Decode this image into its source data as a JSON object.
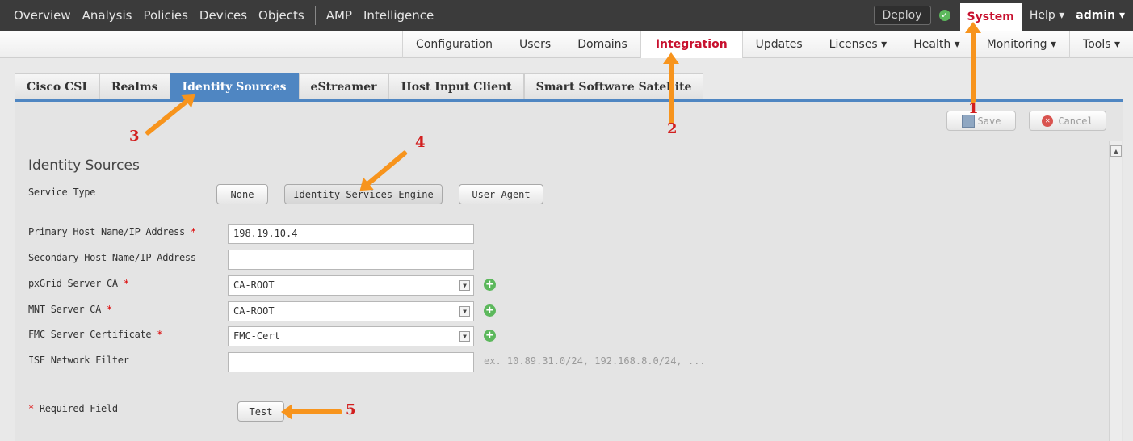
{
  "topnav": {
    "items": [
      "Overview",
      "Analysis",
      "Policies",
      "Devices",
      "Objects",
      "AMP",
      "Intelligence"
    ],
    "deploy": "Deploy",
    "system": "System",
    "help": "Help ▾",
    "admin": "admin ▾"
  },
  "subnav": {
    "items": [
      "Configuration",
      "Users",
      "Domains",
      "Integration",
      "Updates",
      "Licenses ▾",
      "Health ▾",
      "Monitoring ▾",
      "Tools ▾"
    ],
    "active": "Integration"
  },
  "tabs": {
    "items": [
      "Cisco CSI",
      "Realms",
      "Identity Sources",
      "eStreamer",
      "Host Input Client",
      "Smart Software Satellite"
    ],
    "active": "Identity Sources"
  },
  "actions": {
    "save": "Save",
    "cancel": "Cancel"
  },
  "form": {
    "title": "Identity Sources",
    "service_type_label": "Service Type",
    "service_types": [
      "None",
      "Identity Services Engine",
      "User Agent"
    ],
    "primary_host_label": "Primary Host Name/IP Address",
    "primary_host_value": "198.19.10.4",
    "secondary_host_label": "Secondary Host Name/IP Address",
    "secondary_host_value": "",
    "pxgrid_ca_label": "pxGrid Server CA",
    "pxgrid_ca_value": "CA-ROOT",
    "mnt_ca_label": "MNT Server CA",
    "mnt_ca_value": "CA-ROOT",
    "fmc_cert_label": "FMC Server Certificate",
    "fmc_cert_value": "FMC-Cert",
    "ise_filter_label": "ISE Network Filter",
    "ise_filter_value": "",
    "ise_filter_hint": "ex. 10.89.31.0/24, 192.168.8.0/24, ...",
    "required_asterisk": "*",
    "required_note": "Required Field",
    "test": "Test"
  },
  "annotations": [
    "1",
    "2",
    "3",
    "4",
    "5"
  ],
  "colors": {
    "accent_red": "#c8102e",
    "tab_blue": "#4f86c2",
    "arrow_orange": "#f7941d"
  }
}
